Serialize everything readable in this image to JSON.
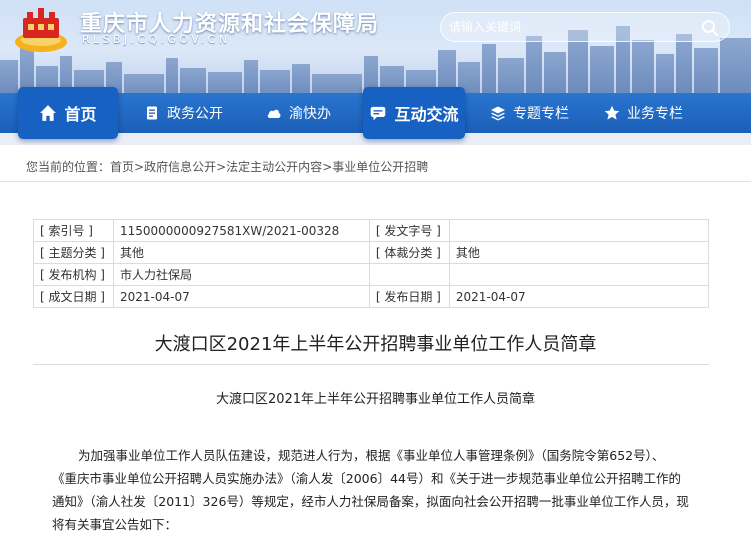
{
  "header": {
    "site_title": "重庆市人力资源和社会保障局",
    "site_domain": "RLSBJ.CQ.GOV.CN",
    "search_placeholder": "请输入关键词",
    "nav_color": "#1a5fb8",
    "nav": [
      {
        "label": "首页",
        "icon": "home-icon"
      },
      {
        "label": "政务公开",
        "icon": "document-icon"
      },
      {
        "label": "渝快办",
        "icon": "cloud-icon"
      },
      {
        "label": "互动交流",
        "icon": "chat-icon"
      },
      {
        "label": "专题专栏",
        "icon": "layers-icon"
      },
      {
        "label": "业务专栏",
        "icon": "star-icon"
      }
    ]
  },
  "breadcrumb": {
    "prefix": "您当前的位置：",
    "items": [
      "首页",
      "政府信息公开",
      "法定主动公开内容",
      "事业单位公开招聘"
    ],
    "separator": ">"
  },
  "meta": {
    "index_label": "[ 索引号 ]",
    "index_value": "1150000000927581XW/2021-00328",
    "doc_no_label": "[ 发文字号 ]",
    "doc_no_value": "",
    "topic_label": "[ 主题分类 ]",
    "topic_value": "其他",
    "genre_label": "[ 体裁分类 ]",
    "genre_value": "其他",
    "issuer_label": "[ 发布机构 ]",
    "issuer_value": "市人力社保局",
    "written_label": "[ 成文日期 ]",
    "written_value": "2021-04-07",
    "published_label": "[ 发布日期 ]",
    "published_value": "2021-04-07"
  },
  "article": {
    "title": "大渡口区2021年上半年公开招聘事业单位工作人员简章",
    "subtitle": "大渡口区2021年上半年公开招聘事业单位工作人员简章",
    "lines": [
      "为加强事业单位工作人员队伍建设，规范进人行为，根据《事业单位人事管理条例》（国务院令第652号）、",
      "《重庆市事业单位公开招聘人员实施办法》（渝人发〔2006〕44号）和《关于进一步规范事业单位公开招聘工作的",
      "通知》（渝人社发〔2011〕326号）等规定，经市人力社保局备案，拟面向社会公开招聘一批事业单位工作人员，现",
      "将有关事宜公告如下："
    ]
  }
}
